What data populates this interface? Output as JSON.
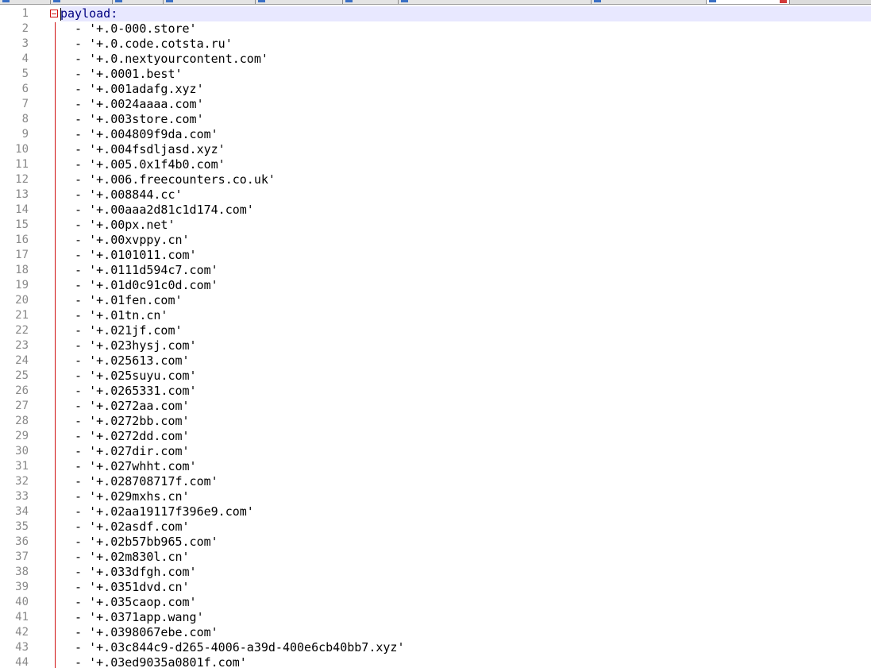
{
  "editor": {
    "lines": [
      {
        "n": "1",
        "text": "payload:"
      },
      {
        "n": "2",
        "text": "  - '+.0-000.store'"
      },
      {
        "n": "3",
        "text": "  - '+.0.code.cotsta.ru'"
      },
      {
        "n": "4",
        "text": "  - '+.0.nextyourcontent.com'"
      },
      {
        "n": "5",
        "text": "  - '+.0001.best'"
      },
      {
        "n": "6",
        "text": "  - '+.001adafg.xyz'"
      },
      {
        "n": "7",
        "text": "  - '+.0024aaaa.com'"
      },
      {
        "n": "8",
        "text": "  - '+.003store.com'"
      },
      {
        "n": "9",
        "text": "  - '+.004809f9da.com'"
      },
      {
        "n": "10",
        "text": "  - '+.004fsdljasd.xyz'"
      },
      {
        "n": "11",
        "text": "  - '+.005.0x1f4b0.com'"
      },
      {
        "n": "12",
        "text": "  - '+.006.freecounters.co.uk'"
      },
      {
        "n": "13",
        "text": "  - '+.008844.cc'"
      },
      {
        "n": "14",
        "text": "  - '+.00aaa2d81c1d174.com'"
      },
      {
        "n": "15",
        "text": "  - '+.00px.net'"
      },
      {
        "n": "16",
        "text": "  - '+.00xvppy.cn'"
      },
      {
        "n": "17",
        "text": "  - '+.0101011.com'"
      },
      {
        "n": "18",
        "text": "  - '+.0111d594c7.com'"
      },
      {
        "n": "19",
        "text": "  - '+.01d0c91c0d.com'"
      },
      {
        "n": "20",
        "text": "  - '+.01fen.com'"
      },
      {
        "n": "21",
        "text": "  - '+.01tn.cn'"
      },
      {
        "n": "22",
        "text": "  - '+.021jf.com'"
      },
      {
        "n": "23",
        "text": "  - '+.023hysj.com'"
      },
      {
        "n": "24",
        "text": "  - '+.025613.com'"
      },
      {
        "n": "25",
        "text": "  - '+.025suyu.com'"
      },
      {
        "n": "26",
        "text": "  - '+.0265331.com'"
      },
      {
        "n": "27",
        "text": "  - '+.0272aa.com'"
      },
      {
        "n": "28",
        "text": "  - '+.0272bb.com'"
      },
      {
        "n": "29",
        "text": "  - '+.0272dd.com'"
      },
      {
        "n": "30",
        "text": "  - '+.027dir.com'"
      },
      {
        "n": "31",
        "text": "  - '+.027whht.com'"
      },
      {
        "n": "32",
        "text": "  - '+.028708717f.com'"
      },
      {
        "n": "33",
        "text": "  - '+.029mxhs.cn'"
      },
      {
        "n": "34",
        "text": "  - '+.02aa19117f396e9.com'"
      },
      {
        "n": "35",
        "text": "  - '+.02asdf.com'"
      },
      {
        "n": "36",
        "text": "  - '+.02b57bb965.com'"
      },
      {
        "n": "37",
        "text": "  - '+.02m830l.cn'"
      },
      {
        "n": "38",
        "text": "  - '+.033dfgh.com'"
      },
      {
        "n": "39",
        "text": "  - '+.0351dvd.cn'"
      },
      {
        "n": "40",
        "text": "  - '+.035caop.com'"
      },
      {
        "n": "41",
        "text": "  - '+.0371app.wang'"
      },
      {
        "n": "42",
        "text": "  - '+.0398067ebe.com'"
      },
      {
        "n": "43",
        "text": "  - '+.03c844c9-d265-4006-a39d-400e6cb40bb7.xyz'"
      },
      {
        "n": "44",
        "text": "  - '+.03ed9035a0801f.com'"
      }
    ]
  },
  "colors": {
    "key": "#000080",
    "line_number": "#8a8a8a",
    "fold_marker": "#d01010",
    "current_line_highlight": "#e8e8ff"
  },
  "icons": {
    "fold": "fold-minus-icon",
    "tab_mark": "file-tab-icon",
    "tab_close": "close-icon"
  }
}
